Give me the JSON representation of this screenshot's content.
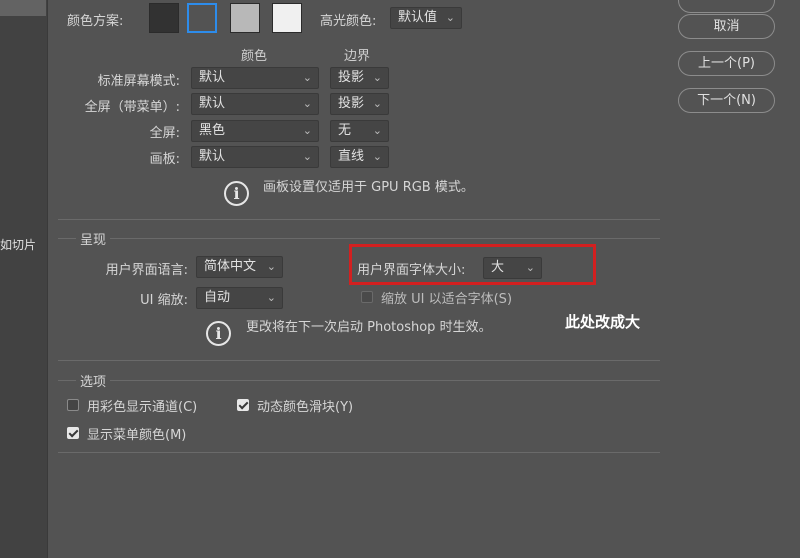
{
  "sidebar": {
    "partial_item": "如切片"
  },
  "appearance": {
    "color_scheme_label": "颜色方案:",
    "swatches": [
      "#323232",
      "#535353",
      "#b8b8b8",
      "#f0f0f0"
    ],
    "highlight_color_label": "高光颜色:",
    "highlight_color_value": "默认值",
    "col_color": "颜色",
    "col_border": "边界",
    "rows": [
      {
        "label": "标准屏幕模式:",
        "color": "默认",
        "border": "投影"
      },
      {
        "label": "全屏（带菜单）:",
        "color": "默认",
        "border": "投影"
      },
      {
        "label": "全屏:",
        "color": "黑色",
        "border": "无"
      },
      {
        "label": "画板:",
        "color": "默认",
        "border": "直线"
      }
    ],
    "artboard_note": "画板设置仅适用于 GPU RGB 模式。"
  },
  "presentation": {
    "title": "呈现",
    "ui_language_label": "用户界面语言:",
    "ui_language_value": "简体中文",
    "ui_font_size_label": "用户界面字体大小:",
    "ui_font_size_value": "大",
    "ui_scaling_label": "UI 缩放:",
    "ui_scaling_value": "自动",
    "scale_to_font_label": "缩放 UI 以适合字体(S)",
    "restart_note": "更改将在下一次启动 Photoshop 时生效。"
  },
  "options": {
    "title": "选项",
    "color_channels_label": "用彩色显示通道(C)",
    "color_channels_checked": false,
    "dynamic_sliders_label": "动态颜色滑块(Y)",
    "dynamic_sliders_checked": true,
    "menu_colors_label": "显示菜单颜色(M)",
    "menu_colors_checked": true
  },
  "buttons": {
    "cancel": "取消",
    "prev": "上一个(P)",
    "next": "下一个(N)"
  },
  "annotation": {
    "text": "此处改成大",
    "color": "#d32020"
  },
  "colors": {
    "accent_focus": "#2d8ceb"
  }
}
